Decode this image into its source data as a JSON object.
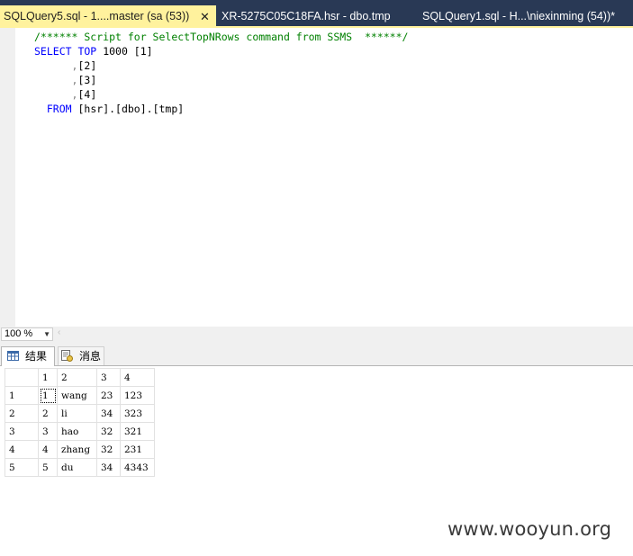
{
  "tabs": [
    {
      "title": "SQLQuery5.sql - 1....master (sa (53))",
      "close": "✕",
      "active": true
    },
    {
      "title": "XR-5275C05C18FA.hsr - dbo.tmp",
      "active": false
    },
    {
      "title": "SQLQuery1.sql - H...\\niexinming (54))*",
      "active": false
    }
  ],
  "editor": {
    "lines": [
      {
        "comment": "/****** Script for SelectTopNRows command from SSMS  ******/"
      },
      {
        "kw": "SELECT TOP",
        "rest": "1000 [1]"
      },
      {
        "sep": ",",
        "rest": "[2]"
      },
      {
        "sep": ",",
        "rest": "[3]"
      },
      {
        "sep": ",",
        "rest": "[4]"
      },
      {
        "kw": "FROM",
        "rest": "[hsr].[dbo].[tmp]",
        "dots": ".."
      }
    ]
  },
  "zoom": {
    "value": "100 %"
  },
  "results_tabs": {
    "results": "结果",
    "messages": "消息"
  },
  "grid": {
    "columns": [
      "1",
      "2",
      "3",
      "4"
    ],
    "rows": [
      {
        "n": "1",
        "cells": [
          "1",
          "wang",
          "23",
          "123"
        ]
      },
      {
        "n": "2",
        "cells": [
          "2",
          "li",
          "34",
          "323"
        ]
      },
      {
        "n": "3",
        "cells": [
          "3",
          "hao",
          "32",
          "321"
        ]
      },
      {
        "n": "4",
        "cells": [
          "4",
          "zhang",
          "32",
          "231"
        ]
      },
      {
        "n": "5",
        "cells": [
          "5",
          "du",
          "34",
          "4343"
        ]
      }
    ]
  },
  "watermark": "www.wooyun.org"
}
